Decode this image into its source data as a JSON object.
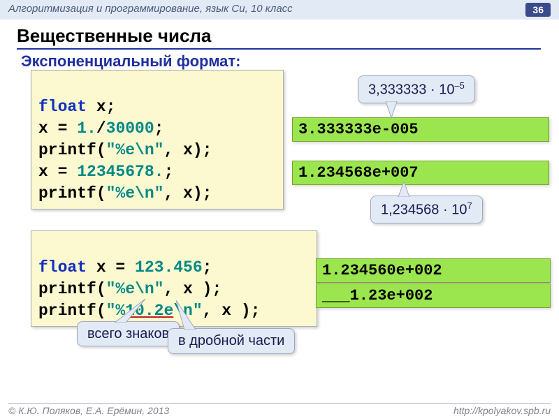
{
  "header": {
    "chapter": "Алгоритмизация и программирование, язык Си, 10 класс",
    "page": "36"
  },
  "title": "Вещественные числа",
  "subtitle": "Экспоненциальный формат:",
  "code1": {
    "l1a": "float",
    "l1b": " x;",
    "l2a": "x = ",
    "l2b": "1.",
    "l2c": "/",
    "l2d": "30000",
    "l2e": ";",
    "l3a": "printf(",
    "l3b": "\"%e\\n\"",
    "l3c": ", x);",
    "l4a": "x = ",
    "l4b": "12345678.",
    "l4c": ";",
    "l5a": "printf(",
    "l5b": "\"%e\\n\"",
    "l5c": ", x);"
  },
  "out1": "3.333333e-005",
  "out2": "1.234568e+007",
  "call1a": "3,333333 · 10",
  "call1b": "–5",
  "call2a": "1,234568 · 10",
  "call2b": "7",
  "code2": {
    "l1a": "float",
    "l1b": " x = ",
    "l1c": "123.456",
    "l1d": ";",
    "l2a": "printf(",
    "l2b": "\"%e\\n\"",
    "l2c": ", x );",
    "l3a": "printf(",
    "l3b": "\"%",
    "l3c": "10.2e",
    "l3d": "\\n\"",
    "l3e": ", x );"
  },
  "out3": "1.234560e+002",
  "out4pre": "   ",
  "out4": "1.23e+002",
  "call3": "всего знаков",
  "call4": "в дробной части",
  "footer": {
    "left": "© К.Ю. Поляков, Е.А. Ерёмин, 2013",
    "right": "http://kpolyakov.spb.ru"
  }
}
